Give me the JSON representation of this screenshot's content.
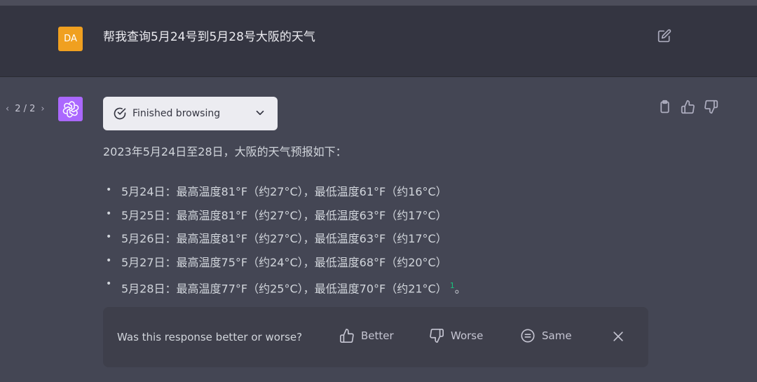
{
  "user": {
    "avatar_text": "DA",
    "message": "帮我查询5月24号到5月28号大阪的天气"
  },
  "assistant": {
    "pager": {
      "prev": "‹",
      "label": "2 / 2",
      "next": "›"
    },
    "browse_label": "Finished browsing",
    "intro": "2023年5月24日至28日，大阪的天气预报如下：",
    "forecast": [
      "5月24日：最高温度81°F（约27°C），最低温度61°F（约16°C）",
      "5月25日：最高温度81°F（约27°C），最低温度63°F（约17°C）",
      "5月26日：最高温度81°F（约27°C），最低温度63°F（约17°C）",
      "5月27日：最高温度75°F（约24°C），最低温度68°F（约20°C）",
      "5月28日：最高温度77°F（约25°C），最低温度70°F（约21°C）"
    ],
    "citation": "1",
    "last_suffix": "。"
  },
  "feedback": {
    "question": "Was this response better or worse?",
    "better": "Better",
    "worse": "Worse",
    "same": "Same"
  },
  "icons": {
    "edit": "edit-icon",
    "copy": "clipboard-icon",
    "thumb_up": "thumbs-up-icon",
    "thumb_down": "thumbs-down-icon",
    "check": "check-circle-icon",
    "chevron": "chevron-down-icon",
    "openai": "openai-logo-icon",
    "same": "equals-circle-icon",
    "close": "close-icon"
  },
  "colors": {
    "user_bg": "#343541",
    "assistant_bg": "#444654",
    "user_avatar": "#f0a020",
    "gpt_avatar": "#ab68ff",
    "citation": "#19c37d"
  }
}
